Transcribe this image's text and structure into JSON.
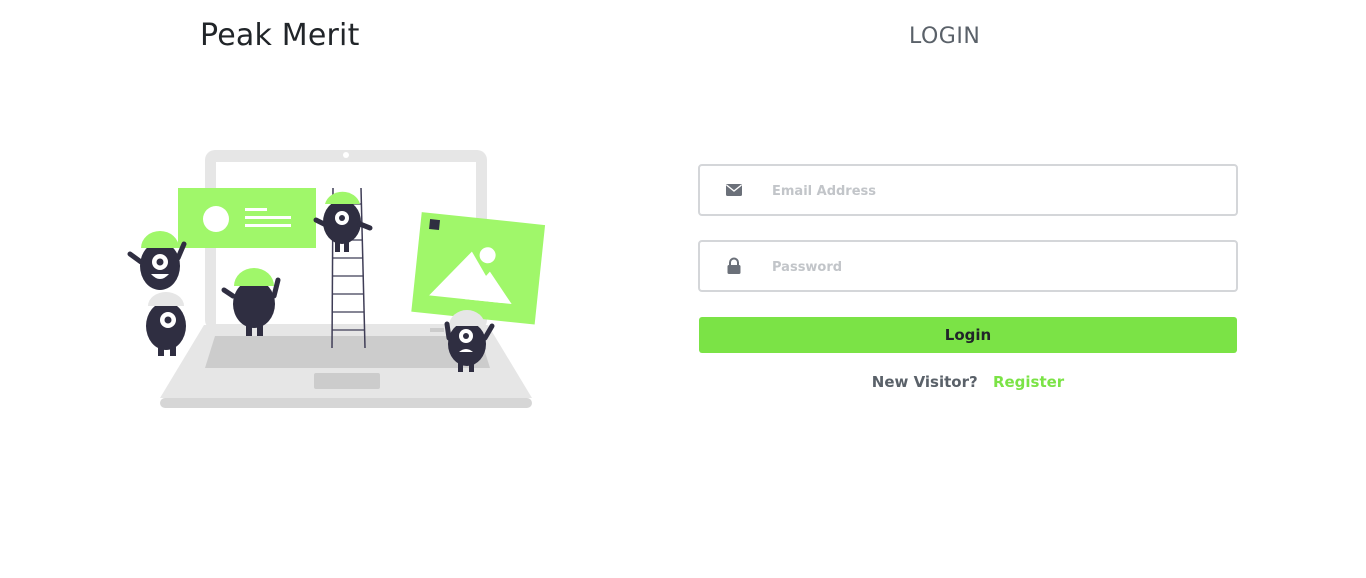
{
  "brand": {
    "name": "Peak Merit"
  },
  "form": {
    "title": "LOGIN",
    "email": {
      "placeholder": "Email Address",
      "value": ""
    },
    "password": {
      "placeholder": "Password",
      "value": ""
    },
    "login_label": "Login",
    "new_visitor_text": "New Visitor?",
    "register_label": "Register"
  },
  "icons": {
    "email": "envelope-icon",
    "password": "lock-icon",
    "illustration": "laptop-monsters-illustration"
  },
  "colors": {
    "accent": "#7be346",
    "illustration_green": "#a0f76a",
    "text_dark": "#212529",
    "text_muted": "#5a6169",
    "border": "#d4d6d9"
  }
}
